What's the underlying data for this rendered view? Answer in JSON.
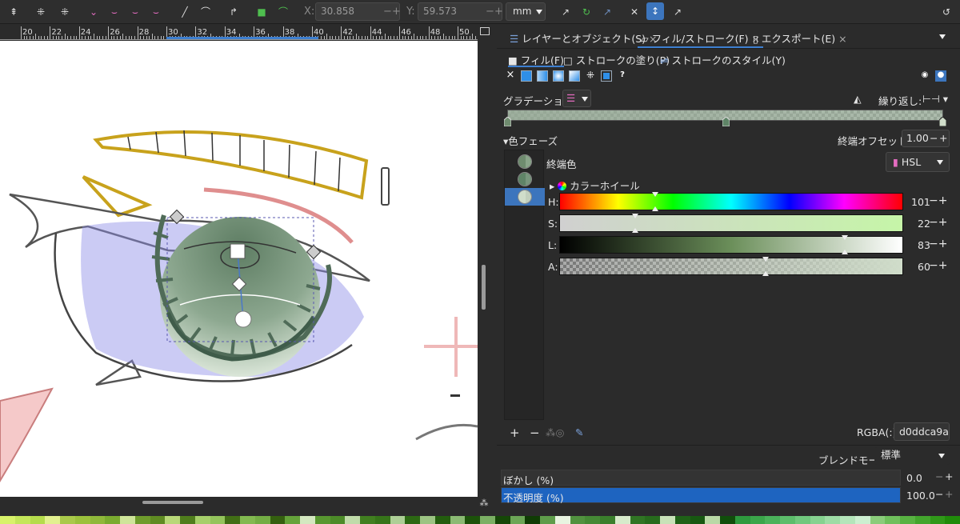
{
  "toolbar": {
    "x_label": "X:",
    "x_value": "30.858",
    "y_label": "Y:",
    "y_value": "59.573",
    "unit": "mm",
    "minus": "−",
    "plus": "+"
  },
  "ruler": {
    "ticks": [
      "20",
      "22",
      "24",
      "26",
      "28",
      "30",
      "32",
      "34",
      "36",
      "38",
      "40",
      "42",
      "44",
      "46",
      "48",
      "50"
    ]
  },
  "dock": {
    "tabs": [
      {
        "label": "レイヤーとオブジェクト(S)",
        "close": "×"
      },
      {
        "label": "フィル/ストローク(F)",
        "close": "×"
      },
      {
        "label": "エクスポート(E)",
        "close": "×"
      }
    ],
    "subtabs": [
      "フィル(F)",
      "ストロークの塗り(P)",
      "ストロークのスタイル(Y)"
    ],
    "paint_help": "?",
    "gradient_label": "グラデーション:",
    "repeat_label": "繰り返し:",
    "phases_label": "色フェーズ",
    "end_offset_label": "終端オフセット:",
    "end_offset_value": "1.00",
    "end_color_label": "終端色",
    "color_mode": "HSL",
    "color_wheel_label": "カラーホイール",
    "sliders": [
      {
        "label": "H:",
        "value": "101",
        "fraction": 0.28
      },
      {
        "label": "S:",
        "value": "22",
        "fraction": 0.22
      },
      {
        "label": "L:",
        "value": "83",
        "fraction": 0.83
      },
      {
        "label": "A:",
        "value": "60",
        "fraction": 0.6
      }
    ],
    "rgba_label": "RGBA(:)",
    "rgba_value": "d0ddca9a",
    "add": "+",
    "remove": "−",
    "blend_label": "ブレンドモード:",
    "blend_value": "標準",
    "blur_label": "ぼかし (%)",
    "blur_value": "0.0",
    "opacity_label": "不透明度 (%)",
    "opacity_value": "100.0",
    "opacity_fraction": 1.0
  },
  "colors": {
    "accent": "#3c75bd",
    "selection_fill": "#1e64c0",
    "stop_colors": [
      "#6f8c6f",
      "#5f8467",
      "#d0ddca"
    ]
  },
  "icons": [
    "align-icon",
    "node-icon",
    "pink-node-icon",
    "pen-icon",
    "transform-handle-icon",
    "gradient-tool-icon",
    "undo-redo-icon"
  ]
}
